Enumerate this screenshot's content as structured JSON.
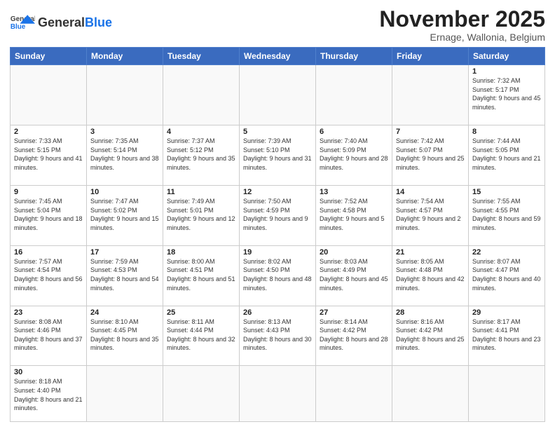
{
  "logo": {
    "general": "General",
    "blue": "Blue"
  },
  "header": {
    "month": "November 2025",
    "location": "Ernage, Wallonia, Belgium"
  },
  "days_of_week": [
    "Sunday",
    "Monday",
    "Tuesday",
    "Wednesday",
    "Thursday",
    "Friday",
    "Saturday"
  ],
  "weeks": [
    [
      {
        "day": "",
        "info": ""
      },
      {
        "day": "",
        "info": ""
      },
      {
        "day": "",
        "info": ""
      },
      {
        "day": "",
        "info": ""
      },
      {
        "day": "",
        "info": ""
      },
      {
        "day": "",
        "info": ""
      },
      {
        "day": "1",
        "info": "Sunrise: 7:32 AM\nSunset: 5:17 PM\nDaylight: 9 hours and 45 minutes."
      }
    ],
    [
      {
        "day": "2",
        "info": "Sunrise: 7:33 AM\nSunset: 5:15 PM\nDaylight: 9 hours and 41 minutes."
      },
      {
        "day": "3",
        "info": "Sunrise: 7:35 AM\nSunset: 5:14 PM\nDaylight: 9 hours and 38 minutes."
      },
      {
        "day": "4",
        "info": "Sunrise: 7:37 AM\nSunset: 5:12 PM\nDaylight: 9 hours and 35 minutes."
      },
      {
        "day": "5",
        "info": "Sunrise: 7:39 AM\nSunset: 5:10 PM\nDaylight: 9 hours and 31 minutes."
      },
      {
        "day": "6",
        "info": "Sunrise: 7:40 AM\nSunset: 5:09 PM\nDaylight: 9 hours and 28 minutes."
      },
      {
        "day": "7",
        "info": "Sunrise: 7:42 AM\nSunset: 5:07 PM\nDaylight: 9 hours and 25 minutes."
      },
      {
        "day": "8",
        "info": "Sunrise: 7:44 AM\nSunset: 5:05 PM\nDaylight: 9 hours and 21 minutes."
      }
    ],
    [
      {
        "day": "9",
        "info": "Sunrise: 7:45 AM\nSunset: 5:04 PM\nDaylight: 9 hours and 18 minutes."
      },
      {
        "day": "10",
        "info": "Sunrise: 7:47 AM\nSunset: 5:02 PM\nDaylight: 9 hours and 15 minutes."
      },
      {
        "day": "11",
        "info": "Sunrise: 7:49 AM\nSunset: 5:01 PM\nDaylight: 9 hours and 12 minutes."
      },
      {
        "day": "12",
        "info": "Sunrise: 7:50 AM\nSunset: 4:59 PM\nDaylight: 9 hours and 9 minutes."
      },
      {
        "day": "13",
        "info": "Sunrise: 7:52 AM\nSunset: 4:58 PM\nDaylight: 9 hours and 5 minutes."
      },
      {
        "day": "14",
        "info": "Sunrise: 7:54 AM\nSunset: 4:57 PM\nDaylight: 9 hours and 2 minutes."
      },
      {
        "day": "15",
        "info": "Sunrise: 7:55 AM\nSunset: 4:55 PM\nDaylight: 8 hours and 59 minutes."
      }
    ],
    [
      {
        "day": "16",
        "info": "Sunrise: 7:57 AM\nSunset: 4:54 PM\nDaylight: 8 hours and 56 minutes."
      },
      {
        "day": "17",
        "info": "Sunrise: 7:59 AM\nSunset: 4:53 PM\nDaylight: 8 hours and 54 minutes."
      },
      {
        "day": "18",
        "info": "Sunrise: 8:00 AM\nSunset: 4:51 PM\nDaylight: 8 hours and 51 minutes."
      },
      {
        "day": "19",
        "info": "Sunrise: 8:02 AM\nSunset: 4:50 PM\nDaylight: 8 hours and 48 minutes."
      },
      {
        "day": "20",
        "info": "Sunrise: 8:03 AM\nSunset: 4:49 PM\nDaylight: 8 hours and 45 minutes."
      },
      {
        "day": "21",
        "info": "Sunrise: 8:05 AM\nSunset: 4:48 PM\nDaylight: 8 hours and 42 minutes."
      },
      {
        "day": "22",
        "info": "Sunrise: 8:07 AM\nSunset: 4:47 PM\nDaylight: 8 hours and 40 minutes."
      }
    ],
    [
      {
        "day": "23",
        "info": "Sunrise: 8:08 AM\nSunset: 4:46 PM\nDaylight: 8 hours and 37 minutes."
      },
      {
        "day": "24",
        "info": "Sunrise: 8:10 AM\nSunset: 4:45 PM\nDaylight: 8 hours and 35 minutes."
      },
      {
        "day": "25",
        "info": "Sunrise: 8:11 AM\nSunset: 4:44 PM\nDaylight: 8 hours and 32 minutes."
      },
      {
        "day": "26",
        "info": "Sunrise: 8:13 AM\nSunset: 4:43 PM\nDaylight: 8 hours and 30 minutes."
      },
      {
        "day": "27",
        "info": "Sunrise: 8:14 AM\nSunset: 4:42 PM\nDaylight: 8 hours and 28 minutes."
      },
      {
        "day": "28",
        "info": "Sunrise: 8:16 AM\nSunset: 4:42 PM\nDaylight: 8 hours and 25 minutes."
      },
      {
        "day": "29",
        "info": "Sunrise: 8:17 AM\nSunset: 4:41 PM\nDaylight: 8 hours and 23 minutes."
      }
    ],
    [
      {
        "day": "30",
        "info": "Sunrise: 8:18 AM\nSunset: 4:40 PM\nDaylight: 8 hours and 21 minutes."
      },
      {
        "day": "",
        "info": ""
      },
      {
        "day": "",
        "info": ""
      },
      {
        "day": "",
        "info": ""
      },
      {
        "day": "",
        "info": ""
      },
      {
        "day": "",
        "info": ""
      },
      {
        "day": "",
        "info": ""
      }
    ]
  ]
}
